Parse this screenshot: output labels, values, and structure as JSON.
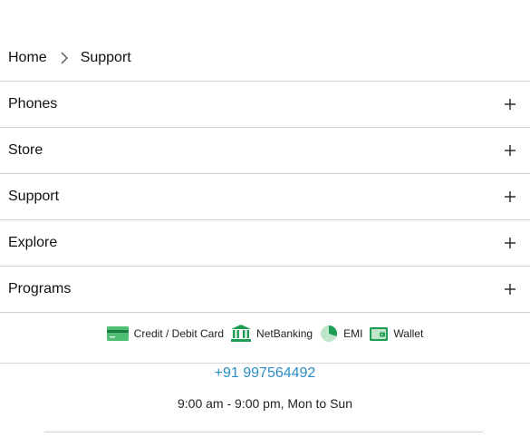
{
  "breadcrumb": {
    "home": "Home",
    "current": "Support"
  },
  "accordion": {
    "items": [
      {
        "label": "Phones"
      },
      {
        "label": "Store"
      },
      {
        "label": "Support"
      },
      {
        "label": "Explore"
      },
      {
        "label": "Programs"
      }
    ]
  },
  "payments": {
    "card": "Credit / Debit Card",
    "netbanking": "NetBanking",
    "emi": "EMI",
    "wallet": "Wallet"
  },
  "contact": {
    "phone": "+91 997564492",
    "hours": "9:00 am - 9:00 pm, Mon to Sun"
  },
  "colors": {
    "accent_green": "#1f9d55",
    "link_blue": "#2a8ec4"
  }
}
